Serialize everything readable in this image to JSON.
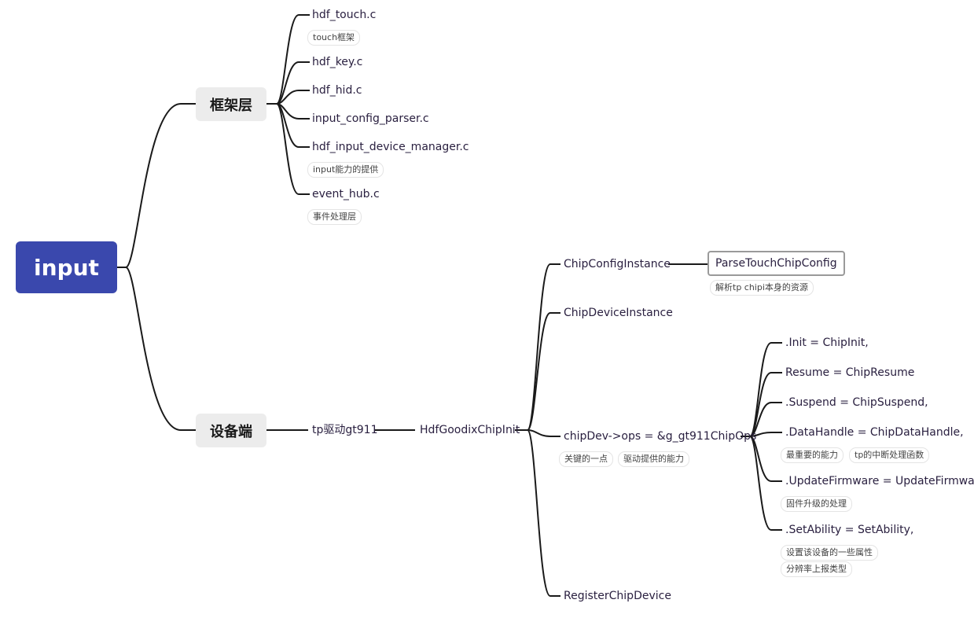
{
  "root": {
    "label": "input",
    "color": "#3a48ad"
  },
  "framework": {
    "label": "框架层",
    "children": [
      {
        "label": "hdf_touch.c",
        "tags": [
          "touch框架"
        ]
      },
      {
        "label": "hdf_key.c",
        "tags": []
      },
      {
        "label": "hdf_hid.c",
        "tags": []
      },
      {
        "label": "input_config_parser.c",
        "tags": []
      },
      {
        "label": "hdf_input_device_manager.c",
        "tags": [
          "input能力的提供"
        ]
      },
      {
        "label": "event_hub.c",
        "tags": [
          "事件处理层"
        ]
      }
    ]
  },
  "device": {
    "label": "设备端",
    "driver": {
      "label": "tp驱动gt911"
    },
    "init": {
      "label": "HdfGoodixChipInit",
      "children": [
        {
          "label": "ChipConfigInstance",
          "child": {
            "label": "ParseTouchChipConfig",
            "tags": [
              "解析tp chipi本身的资源"
            ]
          }
        },
        {
          "label": "ChipDeviceInstance"
        },
        {
          "label": "chipDev->ops = &g_gt911ChipOps",
          "tags": [
            "关键的一点",
            "驱动提供的能力"
          ],
          "ops": [
            {
              "label": ".Init = ChipInit,",
              "tags": []
            },
            {
              "label": "Resume = ChipResume",
              "tags": []
            },
            {
              "label": ".Suspend = ChipSuspend,",
              "tags": []
            },
            {
              "label": ".DataHandle = ChipDataHandle,",
              "tags": [
                "最重要的能力",
                "tp的中断处理函数"
              ]
            },
            {
              "label": ".UpdateFirmware = UpdateFirmware,",
              "tags": [
                "固件升级的处理"
              ]
            },
            {
              "label": ".SetAbility = SetAbility,",
              "tags": [
                "设置该设备的一些属性",
                "分辨率上报类型"
              ]
            }
          ]
        },
        {
          "label": "RegisterChipDevice"
        }
      ]
    }
  }
}
